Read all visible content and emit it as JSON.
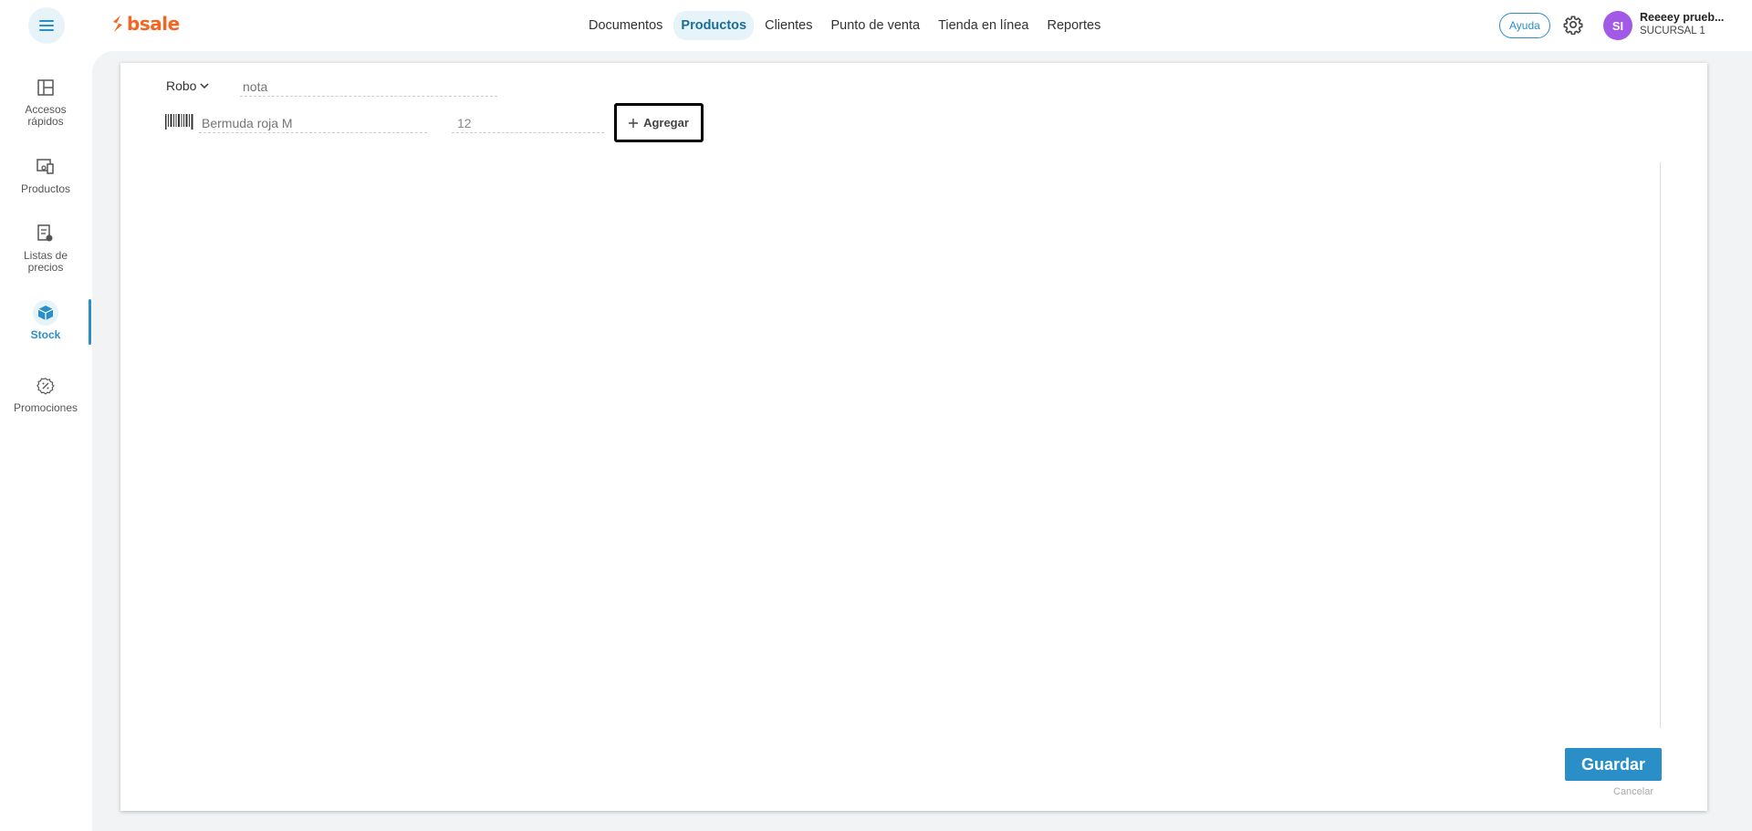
{
  "brand": {
    "name": "bsale",
    "color": "#f26522"
  },
  "topnav": {
    "items": [
      {
        "label": "Documentos"
      },
      {
        "label": "Productos"
      },
      {
        "label": "Clientes"
      },
      {
        "label": "Punto de venta"
      },
      {
        "label": "Tienda en línea"
      },
      {
        "label": "Reportes"
      }
    ],
    "active": "Productos"
  },
  "header": {
    "help_label": "Ayuda",
    "avatar_initials": "SI",
    "user_name": "Reeeey prueb...",
    "branch": "SUCURSAL 1"
  },
  "sidebar": {
    "items": [
      {
        "label_line1": "Accesos",
        "label_line2": "rápidos",
        "icon": "layout-icon"
      },
      {
        "label_line1": "Productos",
        "label_line2": "",
        "icon": "products-icon"
      },
      {
        "label_line1": "Listas de",
        "label_line2": "precios",
        "icon": "price-list-icon"
      },
      {
        "label_line1": "Stock",
        "label_line2": "",
        "icon": "box-icon"
      },
      {
        "label_line1": "Promociones",
        "label_line2": "",
        "icon": "percent-badge-icon"
      }
    ],
    "active": "Stock"
  },
  "form": {
    "type_selected": "Robo",
    "note_placeholder": "nota",
    "product_placeholder": "Bermuda roja M",
    "quantity_value": "12",
    "add_label": "Agregar",
    "save_label": "Guardar",
    "cancel_label": "Cancelar"
  },
  "colors": {
    "accent": "#2a8fc7",
    "active_bg": "#e6f3f9",
    "avatar": "#a259e6"
  }
}
